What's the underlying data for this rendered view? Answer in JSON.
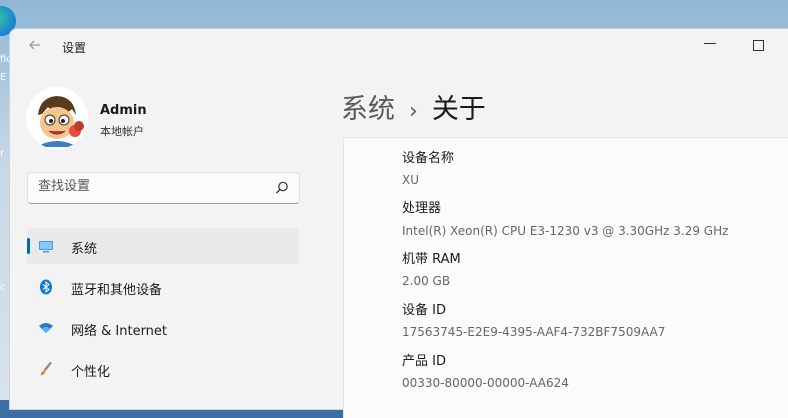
{
  "window": {
    "title": "设置"
  },
  "desktop": {
    "labels": [
      "fic",
      "E",
      "r",
      "c"
    ]
  },
  "user": {
    "name": "Admin",
    "account_type": "本地帐户"
  },
  "search": {
    "placeholder": "查找设置"
  },
  "nav": [
    {
      "label": "系统",
      "icon": "monitor-icon",
      "selected": true
    },
    {
      "label": "蓝牙和其他设备",
      "icon": "bluetooth-icon",
      "selected": false
    },
    {
      "label": "网络 & Internet",
      "icon": "wifi-icon",
      "selected": false
    },
    {
      "label": "个性化",
      "icon": "brush-icon",
      "selected": false
    }
  ],
  "breadcrumb": {
    "parent": "系统",
    "separator": "›",
    "current": "关于"
  },
  "specs": [
    {
      "label": "设备名称",
      "value": "XU"
    },
    {
      "label": "处理器",
      "value": "Intel(R) Xeon(R) CPU E3-1230 v3 @ 3.30GHz   3.29 GHz"
    },
    {
      "label": "机带 RAM",
      "value": "2.00 GB"
    },
    {
      "label": "设备 ID",
      "value": "17563745-E2E9-4395-AAF4-732BF7509AA7"
    },
    {
      "label": "产品 ID",
      "value": "00330-80000-00000-AA624"
    }
  ],
  "colors": {
    "accent": "#0067c0",
    "window_bg": "#f3f3f3",
    "card_bg": "#fbfbfb"
  }
}
